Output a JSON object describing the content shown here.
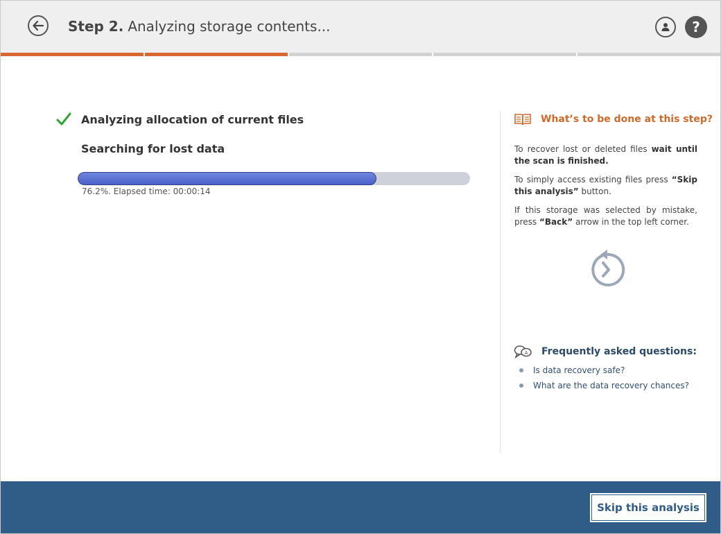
{
  "header": {
    "step_label": "Step 2.",
    "title": "Analyzing storage contents...",
    "icons": {
      "back": "back-arrow-icon",
      "user": "user-icon",
      "help": "help-icon"
    }
  },
  "step_progress": {
    "total": 5,
    "completed": 2
  },
  "scan": {
    "done_task": "Analyzing allocation of current files",
    "current_task": "Searching for lost data",
    "progress_percent": 76.2,
    "progress_text": "76.2%. Elapsed time: 00:00:14"
  },
  "help": {
    "title": "What’s to be done at this step?",
    "p1_a": "To recover lost or deleted files ",
    "p1_b": "wait until the scan is finished.",
    "p2_a": "To simply access existing files press ",
    "p2_b": "“Skip this analysis”",
    "p2_c": " button.",
    "p3_a": "If this storage was selected by mistake, press ",
    "p3_b": "“Back”",
    "p3_c": " arrow in the top left corner."
  },
  "faq": {
    "title": "Frequently asked questions:",
    "items": [
      {
        "label": "Is data recovery safe?"
      },
      {
        "label": "What are the data recovery chances?"
      }
    ]
  },
  "footer": {
    "skip_label": "Skip this analysis"
  },
  "colors": {
    "accent": "#d8682f",
    "footer": "#2f5d88",
    "progress": "#4a61c8",
    "check": "#2aa52a"
  }
}
